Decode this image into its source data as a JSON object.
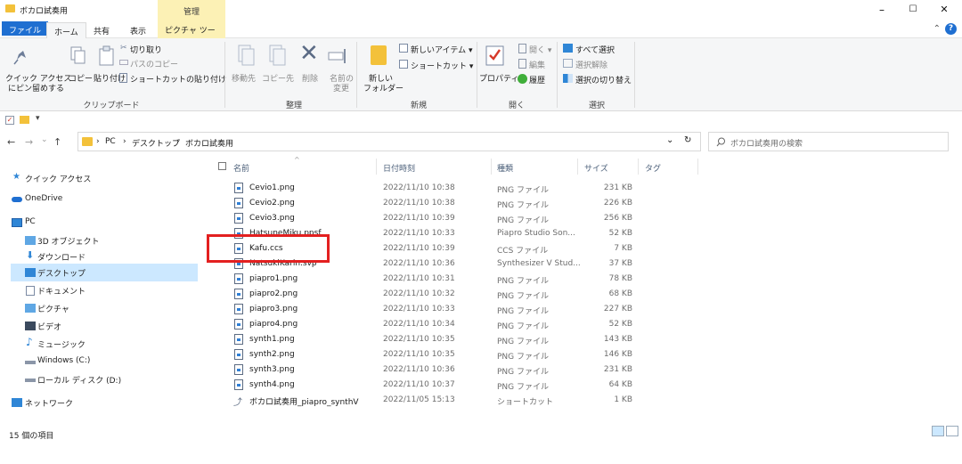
{
  "window": {
    "title": "ボカロ試奏用",
    "context_header": "管理",
    "minimize": "–",
    "maximize": "☐",
    "close": "✕"
  },
  "tabs": {
    "file": "ファイル",
    "home": "ホーム",
    "share": "共有",
    "view": "表示",
    "picture_tools": "ピクチャ ツール"
  },
  "ribbon": {
    "clipboard": {
      "pin_line1": "クイック アクセス",
      "pin_line2": "にピン留めする",
      "copy": "コピー",
      "paste": "貼り付け",
      "cut": "切り取り",
      "copy_path": "パスのコピー",
      "paste_shortcut": "ショートカットの貼り付け",
      "label": "クリップボード"
    },
    "organize": {
      "move_to": "移動先",
      "copy_to": "コピー先",
      "delete": "削除",
      "rename_line1": "名前の",
      "rename_line2": "変更",
      "label": "整理"
    },
    "new": {
      "new_folder_line1": "新しい",
      "new_folder_line2": "フォルダー",
      "new_item": "新しいアイテム ▾",
      "shortcut": "ショートカット ▾",
      "label": "新規"
    },
    "open": {
      "properties": "プロパティ",
      "open": "開く ▾",
      "edit": "編集",
      "history": "履歴",
      "label": "開く"
    },
    "select": {
      "select_all": "すべて選択",
      "select_none": "選択解除",
      "invert": "選択の切り替え",
      "label": "選択"
    }
  },
  "address": {
    "back": "←",
    "forward": "→",
    "recent": "⌄",
    "up": "↑",
    "crumb1": "PC",
    "crumb2": "デスクトップ",
    "crumb3": "ボカロ試奏用",
    "sep": "›",
    "dropdown": "⌄",
    "refresh": "↻",
    "search_placeholder": "ボカロ試奏用の検索"
  },
  "nav": {
    "quick_access": "クイック アクセス",
    "onedrive": "OneDrive",
    "pc": "PC",
    "objects3d": "3D オブジェクト",
    "downloads": "ダウンロード",
    "desktop": "デスクトップ",
    "documents": "ドキュメント",
    "pictures": "ピクチャ",
    "videos": "ビデオ",
    "music": "ミュージック",
    "windows_c": "Windows (C:)",
    "local_d": "ローカル ディスク (D:)",
    "network": "ネットワーク"
  },
  "columns": {
    "name": "名前",
    "date": "日付時刻",
    "type": "種類",
    "size": "サイズ",
    "tag": "タグ"
  },
  "files": [
    {
      "name": "Cevio1.png",
      "date": "2022/11/10 10:38",
      "type": "PNG ファイル",
      "size": "231 KB"
    },
    {
      "name": "Cevio2.png",
      "date": "2022/11/10 10:38",
      "type": "PNG ファイル",
      "size": "226 KB"
    },
    {
      "name": "Cevio3.png",
      "date": "2022/11/10 10:39",
      "type": "PNG ファイル",
      "size": "256 KB"
    },
    {
      "name": "HatsuneMiku.ppsf",
      "date": "2022/11/10 10:33",
      "type": "Piapro Studio Son...",
      "size": "52 KB"
    },
    {
      "name": "Kafu.ccs",
      "date": "2022/11/10 10:39",
      "type": "CCS ファイル",
      "size": "7 KB"
    },
    {
      "name": "NatsukiKarin.svp",
      "date": "2022/11/10 10:36",
      "type": "Synthesizer V Stud...",
      "size": "37 KB"
    },
    {
      "name": "piapro1.png",
      "date": "2022/11/10 10:31",
      "type": "PNG ファイル",
      "size": "78 KB"
    },
    {
      "name": "piapro2.png",
      "date": "2022/11/10 10:32",
      "type": "PNG ファイル",
      "size": "68 KB"
    },
    {
      "name": "piapro3.png",
      "date": "2022/11/10 10:33",
      "type": "PNG ファイル",
      "size": "227 KB"
    },
    {
      "name": "piapro4.png",
      "date": "2022/11/10 10:34",
      "type": "PNG ファイル",
      "size": "52 KB"
    },
    {
      "name": "synth1.png",
      "date": "2022/11/10 10:35",
      "type": "PNG ファイル",
      "size": "143 KB"
    },
    {
      "name": "synth2.png",
      "date": "2022/11/10 10:35",
      "type": "PNG ファイル",
      "size": "146 KB"
    },
    {
      "name": "synth3.png",
      "date": "2022/11/10 10:36",
      "type": "PNG ファイル",
      "size": "231 KB"
    },
    {
      "name": "synth4.png",
      "date": "2022/11/10 10:37",
      "type": "PNG ファイル",
      "size": "64 KB"
    },
    {
      "name": "ボカロ試奏用_piapro_synthV",
      "date": "2022/11/05 15:13",
      "type": "ショートカット",
      "size": "1 KB"
    }
  ],
  "status": {
    "count": "15 個の項目"
  },
  "colors": {
    "accent": "#1f6fd1",
    "selection": "#cce8ff",
    "highlight": "#e32020",
    "context_tab": "#fcf1b5"
  }
}
